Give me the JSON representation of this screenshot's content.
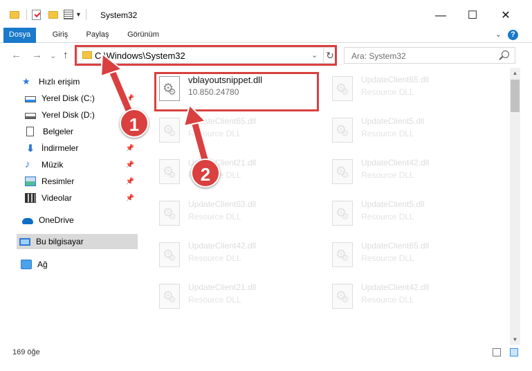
{
  "window": {
    "title": "System32",
    "minimize_glyph": "—",
    "maximize_glyph": "☐",
    "close_glyph": "✕"
  },
  "ribbon": {
    "tabs": [
      {
        "label": "Dosya"
      },
      {
        "label": "Giriş"
      },
      {
        "label": "Paylaş"
      },
      {
        "label": "Görünüm"
      }
    ],
    "help_glyph": "?",
    "expand_glyph": "⌄"
  },
  "nav": {
    "back_glyph": "←",
    "forward_glyph": "→",
    "recent_glyph": "⌄",
    "up_glyph": "↑",
    "address": "C:\\Windows\\System32",
    "address_dropdown_glyph": "⌄",
    "refresh_glyph": "↻",
    "search_placeholder": "Ara: System32"
  },
  "sidebar": {
    "items": [
      {
        "label": "Hızlı erişim",
        "icon": "star-icon",
        "glyph": "★"
      },
      {
        "label": "Yerel Disk (C:)",
        "icon": "drive-icon",
        "pinned": true
      },
      {
        "label": "Yerel Disk (D:)",
        "icon": "drive-icon"
      },
      {
        "label": "Belgeler",
        "icon": "document-icon",
        "pinned": true
      },
      {
        "label": "İndirmeler",
        "icon": "download-icon",
        "glyph": "⬇",
        "pinned": true
      },
      {
        "label": "Müzik",
        "icon": "music-icon",
        "glyph": "♪",
        "pinned": true
      },
      {
        "label": "Resimler",
        "icon": "pictures-icon",
        "pinned": true
      },
      {
        "label": "Videolar",
        "icon": "videos-icon",
        "pinned": true
      },
      {
        "label": "OneDrive",
        "icon": "cloud-icon"
      },
      {
        "label": "Bu bilgisayar",
        "icon": "computer-icon",
        "selected": true
      },
      {
        "label": "Ağ",
        "icon": "network-icon"
      }
    ],
    "pin_glyph": "📌"
  },
  "files": {
    "main": {
      "name": "vblayoutsnippet.dll",
      "version": "10.850.24780"
    },
    "others": [
      {
        "name": "UpdateClient65.dll",
        "desc": "Resource DLL"
      },
      {
        "name": "UpdateClient65.dll",
        "desc": "Resource DLL"
      },
      {
        "name": "UpdateClient5.dll",
        "desc": "Resource DLL"
      },
      {
        "name": "UpdateClient21.dll",
        "desc": "Resource DLL"
      },
      {
        "name": "UpdateClient42.dll",
        "desc": "Resource DLL"
      },
      {
        "name": "UpdateClient63.dll",
        "desc": "Resource DLL"
      },
      {
        "name": "UpdateClient5.dll",
        "desc": "Resource DLL"
      },
      {
        "name": "UpdateClient42.dll",
        "desc": "Resource DLL"
      },
      {
        "name": "UpdateClient65.dll",
        "desc": "Resource DLL"
      },
      {
        "name": "UpdateClient21.dll",
        "desc": "Resource DLL"
      },
      {
        "name": "UpdateClient42.dll",
        "desc": "Resource DLL"
      }
    ]
  },
  "status": {
    "item_count": "169 öğe"
  },
  "scroll": {
    "up_glyph": "▲",
    "down_glyph": "▼"
  },
  "annotations": {
    "step1": "1",
    "step2": "2",
    "color": "#d9403f"
  }
}
